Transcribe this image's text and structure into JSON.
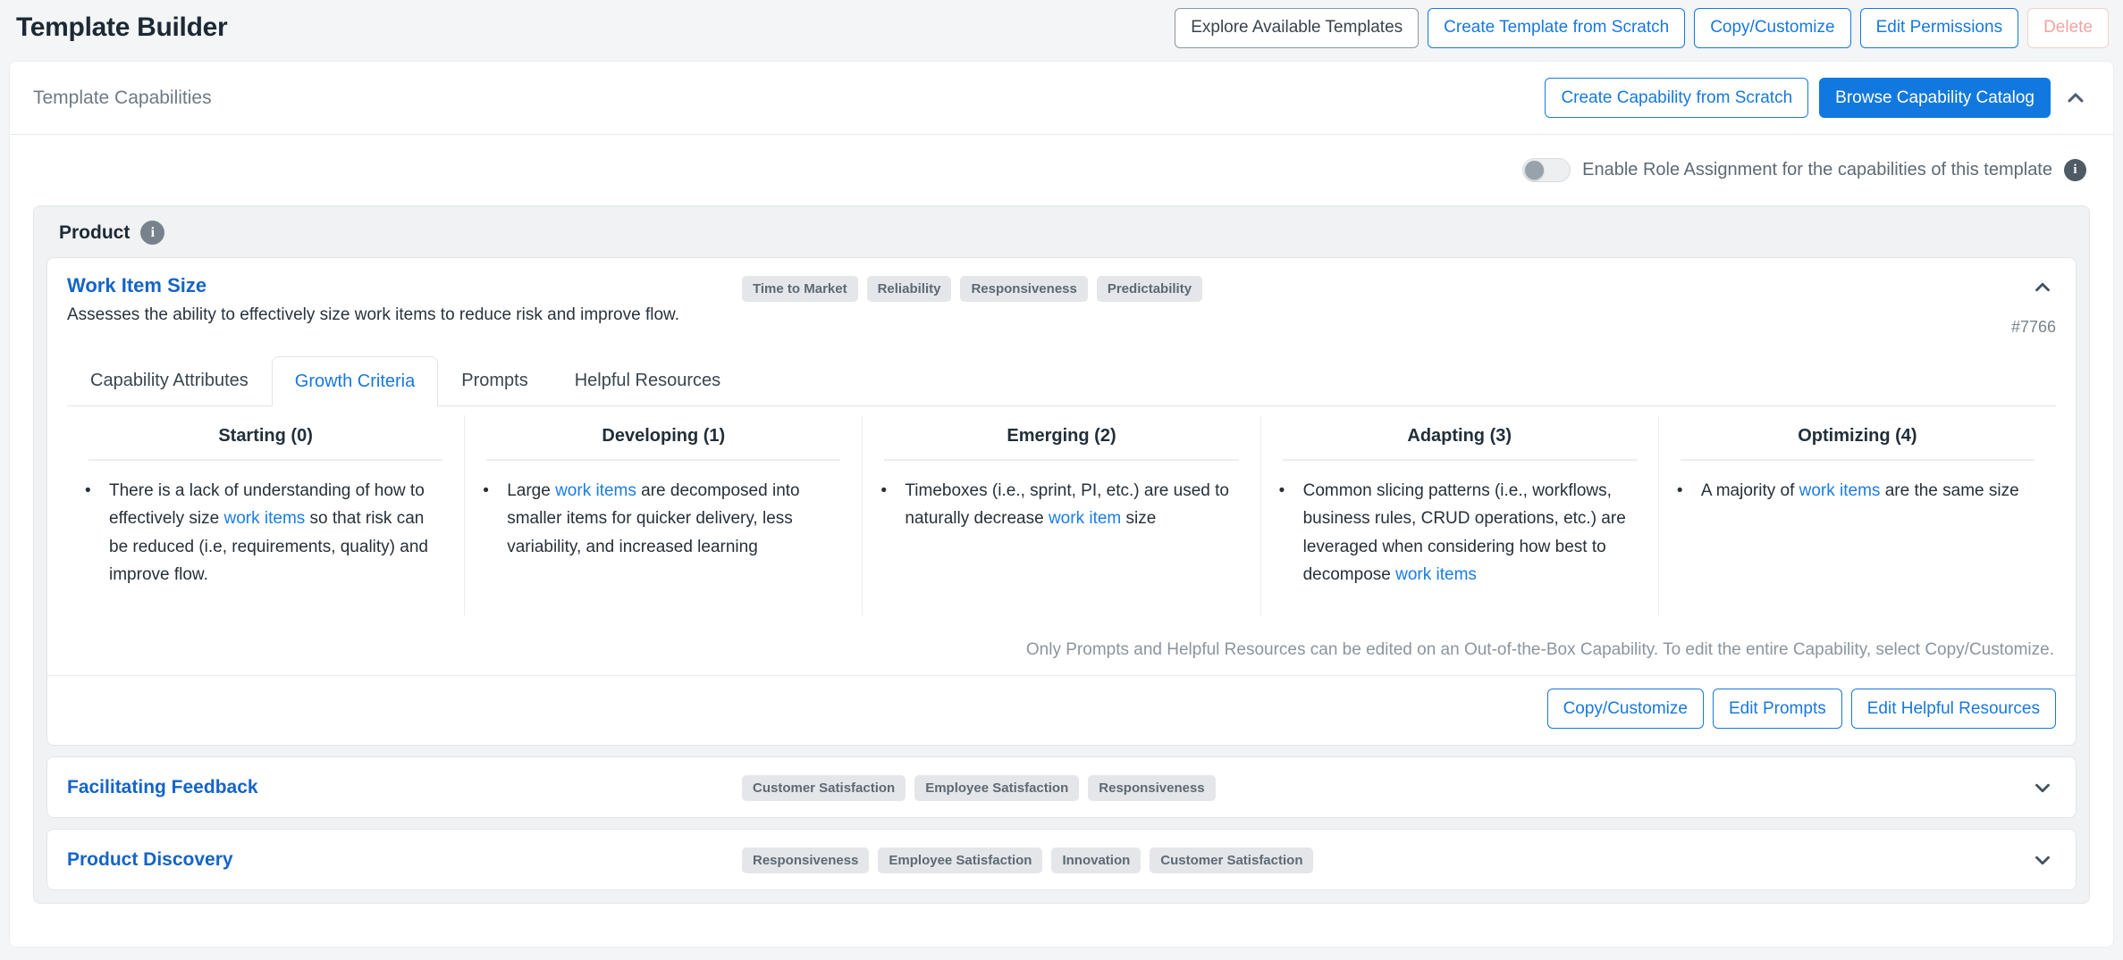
{
  "colors": {
    "accent_blue": "#1778df",
    "title_blue": "#1464c8",
    "solid_button_bg": "#1178df",
    "tag_bg": "#e4e6e9",
    "danger_text": "#f0a3a3",
    "page_bg": "#f3f5f6"
  },
  "icons": {
    "collapse": "chevron-up-icon",
    "expand": "chevron-down-icon",
    "info": "info-circle-icon"
  },
  "header": {
    "title": "Template Builder",
    "actions": [
      {
        "label": "Explore Available Templates"
      },
      {
        "label": "Create Template from Scratch"
      },
      {
        "label": "Copy/Customize"
      },
      {
        "label": "Edit Permissions"
      },
      {
        "label": "Delete"
      }
    ]
  },
  "panel": {
    "title": "Template Capabilities",
    "create_button": "Create Capability from Scratch",
    "browse_button": "Browse Capability Catalog",
    "role_toggle": {
      "label": "Enable Role Assignment for the capabilities of this template",
      "state": "off",
      "info_glyph": "i"
    }
  },
  "section": {
    "title": "Product",
    "info_glyph": "i"
  },
  "work_item_card": {
    "title": "Work Item Size",
    "tags": [
      "Time to Market",
      "Reliability",
      "Responsiveness",
      "Predictability"
    ],
    "description": "Assesses the ability to effectively size work items to reduce risk and improve flow.",
    "id": "#7766",
    "tabs": [
      {
        "label": "Capability Attributes",
        "active": false
      },
      {
        "label": "Growth Criteria",
        "active": true
      },
      {
        "label": "Prompts",
        "active": false
      },
      {
        "label": "Helpful Resources",
        "active": false
      }
    ],
    "bullet_glyph": "•",
    "columns": [
      {
        "header": "Starting (0)",
        "bullet": {
          "pre": "There is a lack of understanding of how to effectively size ",
          "link": "work items",
          "post": " so that risk can be reduced (i.e, requirements, quality) and improve flow."
        }
      },
      {
        "header": "Developing (1)",
        "bullet": {
          "pre": "Large ",
          "link": "work items",
          "post": " are decomposed into smaller items for quicker delivery, less variability, and increased learning"
        }
      },
      {
        "header": "Emerging (2)",
        "bullet": {
          "pre": "Timeboxes (i.e., sprint, PI, etc.) are used to naturally decrease ",
          "link": "work item",
          "post": " size"
        }
      },
      {
        "header": "Adapting (3)",
        "bullet": {
          "pre": "Common slicing patterns (i.e., workflows, business rules, CRUD operations, etc.) are leveraged when considering how best to decompose ",
          "link": "work items",
          "post": ""
        }
      },
      {
        "header": "Optimizing (4)",
        "bullet": {
          "pre": "A majority of ",
          "link": "work items",
          "post": " are the same size"
        }
      }
    ],
    "note": "Only Prompts and Helpful Resources can be edited on an Out-of-the-Box Capability. To edit the entire Capability, select Copy/Customize.",
    "footer_buttons": [
      {
        "label": "Copy/Customize"
      },
      {
        "label": "Edit Prompts"
      },
      {
        "label": "Edit Helpful Resources"
      }
    ]
  },
  "collapsed_cards": [
    {
      "title": "Facilitating Feedback",
      "tags": [
        "Customer Satisfaction",
        "Employee Satisfaction",
        "Responsiveness"
      ]
    },
    {
      "title": "Product Discovery",
      "tags": [
        "Responsiveness",
        "Employee Satisfaction",
        "Innovation",
        "Customer Satisfaction"
      ]
    }
  ]
}
